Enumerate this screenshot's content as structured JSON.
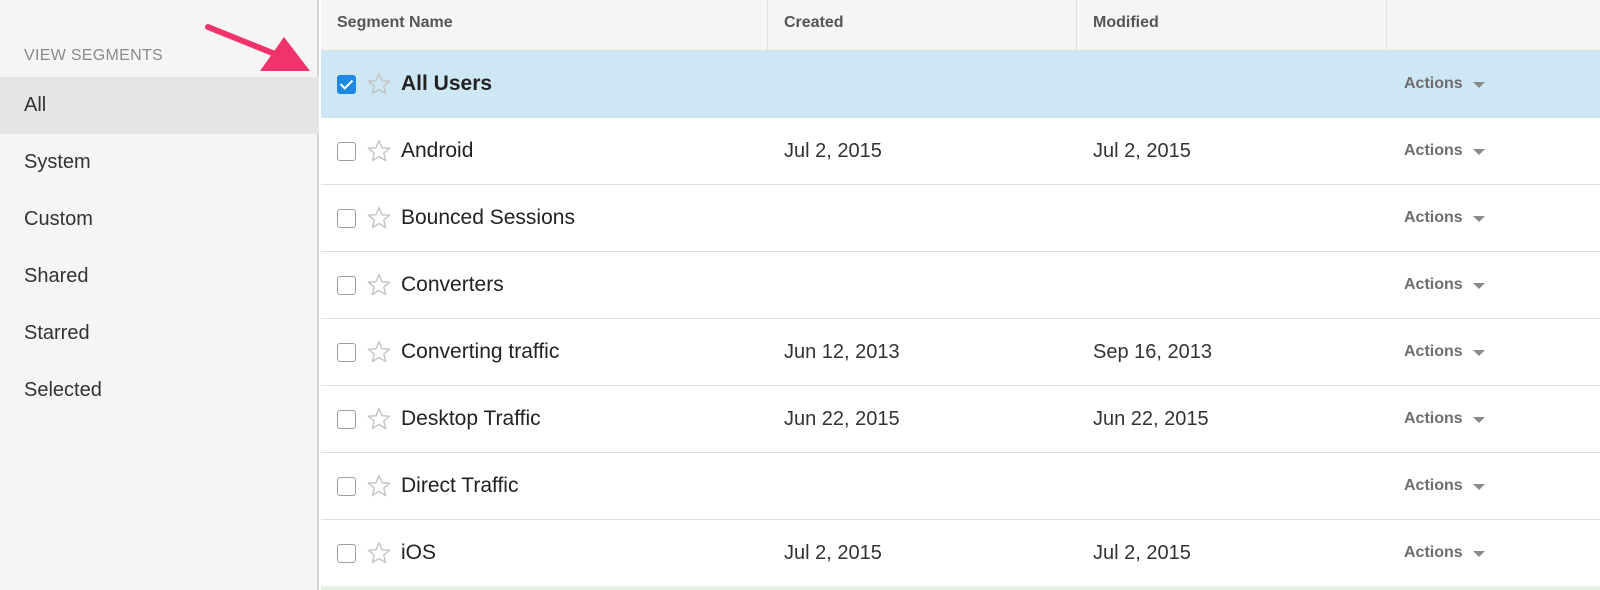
{
  "sidebar": {
    "heading": "VIEW SEGMENTS",
    "items": [
      {
        "label": "All",
        "active": true
      },
      {
        "label": "System"
      },
      {
        "label": "Custom"
      },
      {
        "label": "Shared"
      },
      {
        "label": "Starred"
      },
      {
        "label": "Selected"
      }
    ]
  },
  "table": {
    "headers": {
      "name": "Segment Name",
      "created": "Created",
      "modified": "Modified",
      "actions": ""
    },
    "rows": [
      {
        "name": "All Users",
        "created": "",
        "modified": "",
        "actions": "Actions",
        "checked": true
      },
      {
        "name": "Android",
        "created": "Jul 2, 2015",
        "modified": "Jul 2, 2015",
        "actions": "Actions",
        "checked": false
      },
      {
        "name": "Bounced Sessions",
        "created": "",
        "modified": "",
        "actions": "Actions",
        "checked": false
      },
      {
        "name": "Converters",
        "created": "",
        "modified": "",
        "actions": "Actions",
        "checked": false
      },
      {
        "name": "Converting traffic",
        "created": "Jun 12, 2013",
        "modified": "Sep 16, 2013",
        "actions": "Actions",
        "checked": false
      },
      {
        "name": "Desktop Traffic",
        "created": "Jun 22, 2015",
        "modified": "Jun 22, 2015",
        "actions": "Actions",
        "checked": false
      },
      {
        "name": "Direct Traffic",
        "created": "",
        "modified": "",
        "actions": "Actions",
        "checked": false
      },
      {
        "name": "iOS",
        "created": "Jul 2, 2015",
        "modified": "Jul 2, 2015",
        "actions": "Actions",
        "checked": false
      }
    ]
  },
  "annotation": {
    "icon": "arrow-icon",
    "color": "#f0346b"
  },
  "colors": {
    "selected_row": "#cde7f4",
    "checkbox_checked": "#1e88e5",
    "sidebar_bg": "#f5f5f5",
    "sidebar_active": "#e5e5e5"
  }
}
